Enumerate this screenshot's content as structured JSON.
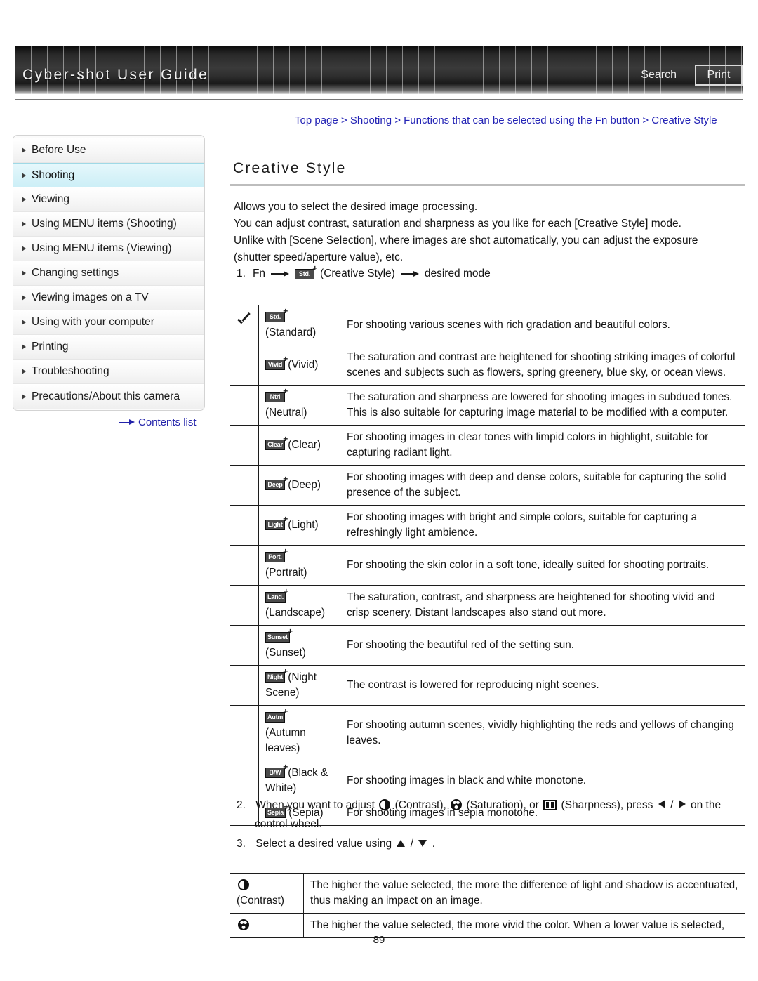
{
  "header": {
    "title": "Cyber-shot User Guide",
    "search_label": "Search",
    "print_label": "Print"
  },
  "sidebar": {
    "items": [
      {
        "label": "Before Use",
        "selected": false
      },
      {
        "label": "Shooting",
        "selected": true
      },
      {
        "label": "Viewing",
        "selected": false
      },
      {
        "label": "Using MENU items (Shooting)",
        "selected": false
      },
      {
        "label": "Using MENU items (Viewing)",
        "selected": false
      },
      {
        "label": "Changing settings",
        "selected": false
      },
      {
        "label": "Viewing images on a TV",
        "selected": false
      },
      {
        "label": "Using with your computer",
        "selected": false
      },
      {
        "label": "Printing",
        "selected": false
      },
      {
        "label": "Troubleshooting",
        "selected": false
      },
      {
        "label": "Precautions/About this camera",
        "selected": false
      }
    ],
    "contents_list_label": "Contents list"
  },
  "main": {
    "breadcrumb": "Top page > Shooting > Functions that can be selected using the Fn button > Creative Style",
    "title": "Creative Style",
    "intro_lines": [
      "Allows you to select the desired image processing.",
      "You can adjust contrast, saturation and sharpness as you like for each [Creative Style] mode.",
      "Unlike with [Scene Selection], where images are shot automatically, you can adjust the exposure",
      "(shutter speed/aperture value), etc."
    ],
    "step1": {
      "number": "1.",
      "prefix": "Fn",
      "badge": "Std.",
      "middle": "(Creative Style)",
      "suffix": "desired mode"
    },
    "step2": {
      "number": "2.",
      "part1": "When you want to adjust",
      "part2": "(Contrast),",
      "part3": "(Saturation), or",
      "part4": "(Sharpness), press",
      "part5": "/",
      "part6": "on the",
      "part7": "control wheel."
    },
    "step3": {
      "number": "3.",
      "part1": "Select a desired value using",
      "part2": "/",
      "part3": "."
    },
    "style_rows": [
      {
        "checked": true,
        "badge": "Std.",
        "name": "(Standard)",
        "inline": false,
        "desc": "For shooting various scenes with rich gradation and beautiful colors."
      },
      {
        "checked": false,
        "badge": "Vivid",
        "name": "(Vivid)",
        "inline": true,
        "desc": "The saturation and contrast are heightened for shooting striking images of colorful scenes and subjects such as flowers, spring greenery, blue sky, or ocean views."
      },
      {
        "checked": false,
        "badge": "Ntrl",
        "name": "(Neutral)",
        "inline": false,
        "desc": "The saturation and sharpness are lowered for shooting images in subdued tones. This is also suitable for capturing image material to be modified with a computer."
      },
      {
        "checked": false,
        "badge": "Clear",
        "name": "(Clear)",
        "inline": true,
        "desc": "For shooting images in clear tones with limpid colors in highlight, suitable for capturing radiant light."
      },
      {
        "checked": false,
        "badge": "Deep",
        "name": "(Deep)",
        "inline": true,
        "desc": "For shooting images with deep and dense colors, suitable for capturing the solid presence of the subject."
      },
      {
        "checked": false,
        "badge": "Light",
        "name": "(Light)",
        "inline": true,
        "desc": "For shooting images with bright and simple colors, suitable for capturing a refreshingly light ambience."
      },
      {
        "checked": false,
        "badge": "Port.",
        "name": "(Portrait)",
        "inline": false,
        "desc": "For shooting the skin color in a soft tone, ideally suited for shooting portraits."
      },
      {
        "checked": false,
        "badge": "Land.",
        "name": "(Landscape)",
        "inline": false,
        "desc": "The saturation, contrast, and sharpness are heightened for shooting vivid and crisp scenery. Distant landscapes also stand out more."
      },
      {
        "checked": false,
        "badge": "Sunset",
        "name": "(Sunset)",
        "inline": false,
        "desc": "For shooting the beautiful red of the setting sun."
      },
      {
        "checked": false,
        "badge": "Night",
        "name": "(Night Scene)",
        "inline": true,
        "desc": "The contrast is lowered for reproducing night scenes."
      },
      {
        "checked": false,
        "badge": "Autm",
        "name": "(Autumn leaves)",
        "inline": false,
        "desc": "For shooting autumn scenes, vividly highlighting the reds and yellows of changing leaves."
      },
      {
        "checked": false,
        "badge": "B/W",
        "name": "(Black & White)",
        "inline": true,
        "desc": "For shooting images in black and white monotone."
      },
      {
        "checked": false,
        "badge": "Sepia",
        "name": "(Sepia)",
        "inline": true,
        "desc": "For shooting images in sepia monotone."
      }
    ],
    "adjust_rows": [
      {
        "icon": "contrast-icon",
        "name": "(Contrast)",
        "desc": "The higher the value selected, the more the difference of light and shadow is accentuated, thus making an impact on an image."
      },
      {
        "icon": "saturation-icon",
        "name": "",
        "desc": "The higher the value selected, the more vivid the color. When a lower value is selected,"
      }
    ]
  },
  "footer": {
    "page_number": "89"
  }
}
